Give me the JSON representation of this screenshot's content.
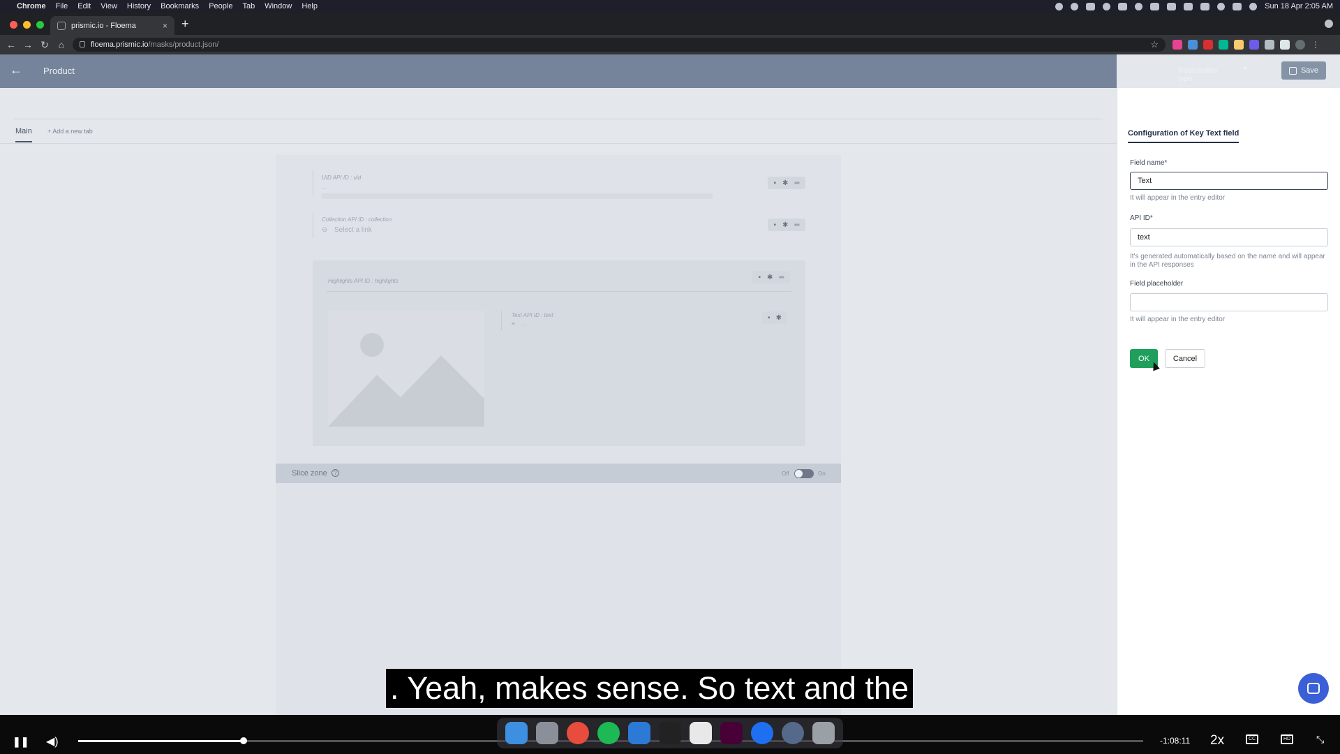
{
  "menubar": {
    "apple": "",
    "items": [
      "Chrome",
      "File",
      "Edit",
      "View",
      "History",
      "Bookmarks",
      "People",
      "Tab",
      "Window",
      "Help"
    ],
    "datetime": "Sun 18 Apr  2:05 AM"
  },
  "browser": {
    "tab_title": "prismic.io - Floema",
    "tab_close": "×",
    "new_tab": "+",
    "url_host": "floema.prismic.io",
    "url_path": "/masks/product.json/"
  },
  "app": {
    "back": "←",
    "title": "Product",
    "repeatable_type": "Repeatable type",
    "save": "Save"
  },
  "tabs": {
    "main": "Main",
    "add": "+ Add a new tab"
  },
  "fields": {
    "uid_label": "UID  API ID : uid",
    "uid_value": "...",
    "collection_label": "Collection  API ID : collection",
    "collection_placeholder": "Select a link",
    "highlights_label": "Highlights  API ID : highlights",
    "text_label": "Text  API ID : text",
    "text_value": "..."
  },
  "slice_zone": {
    "label": "Slice zone",
    "help": "?",
    "off": "Off",
    "on": "On",
    "enabled": false
  },
  "config_panel": {
    "title": "Configuration of Key Text field",
    "field_name_label": "Field name*",
    "field_name_value": "Text",
    "field_name_hint": "It will appear in the entry editor",
    "api_id_label": "API ID*",
    "api_id_value": "text",
    "api_id_hint": "It's generated automatically based on the name and will appear in the API responses",
    "placeholder_label": "Field placeholder",
    "placeholder_value": "",
    "placeholder_hint": "It will appear in the entry editor",
    "ok": "OK",
    "cancel": "Cancel"
  },
  "subtitle": ". Yeah, makes sense. So text and the",
  "video": {
    "time": "-1:08:11",
    "speed": "2x",
    "cc": "CC",
    "hd": "HD",
    "progress": 0.155
  },
  "colors": {
    "header": "#75849a",
    "ok_button": "#1f9e5c",
    "chat_bubble": "#3b5fd6"
  }
}
